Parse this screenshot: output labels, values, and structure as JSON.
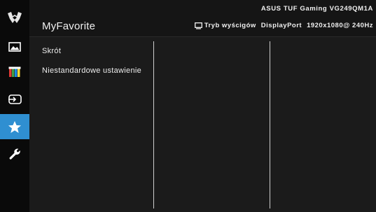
{
  "header": {
    "title": "MyFavorite",
    "model": "ASUS TUF Gaming  VG249QM1A",
    "mode_label": "Tryb wyścigów",
    "input_label": "DisplayPort",
    "resolution_label": "1920x1080@ 240Hz"
  },
  "sidebar": {
    "items": [
      {
        "icon": "tuf-logo-icon"
      },
      {
        "icon": "image-icon"
      },
      {
        "icon": "color-bars-icon"
      },
      {
        "icon": "input-select-icon"
      },
      {
        "icon": "star-icon",
        "active": true
      },
      {
        "icon": "wrench-icon"
      }
    ]
  },
  "menu": {
    "items": [
      {
        "label": "Skrót"
      },
      {
        "label": "Niestandardowe ustawienie"
      }
    ]
  },
  "colors": {
    "accent": "#2f8fd1",
    "background": "#161616",
    "text": "#f0f0f0"
  }
}
